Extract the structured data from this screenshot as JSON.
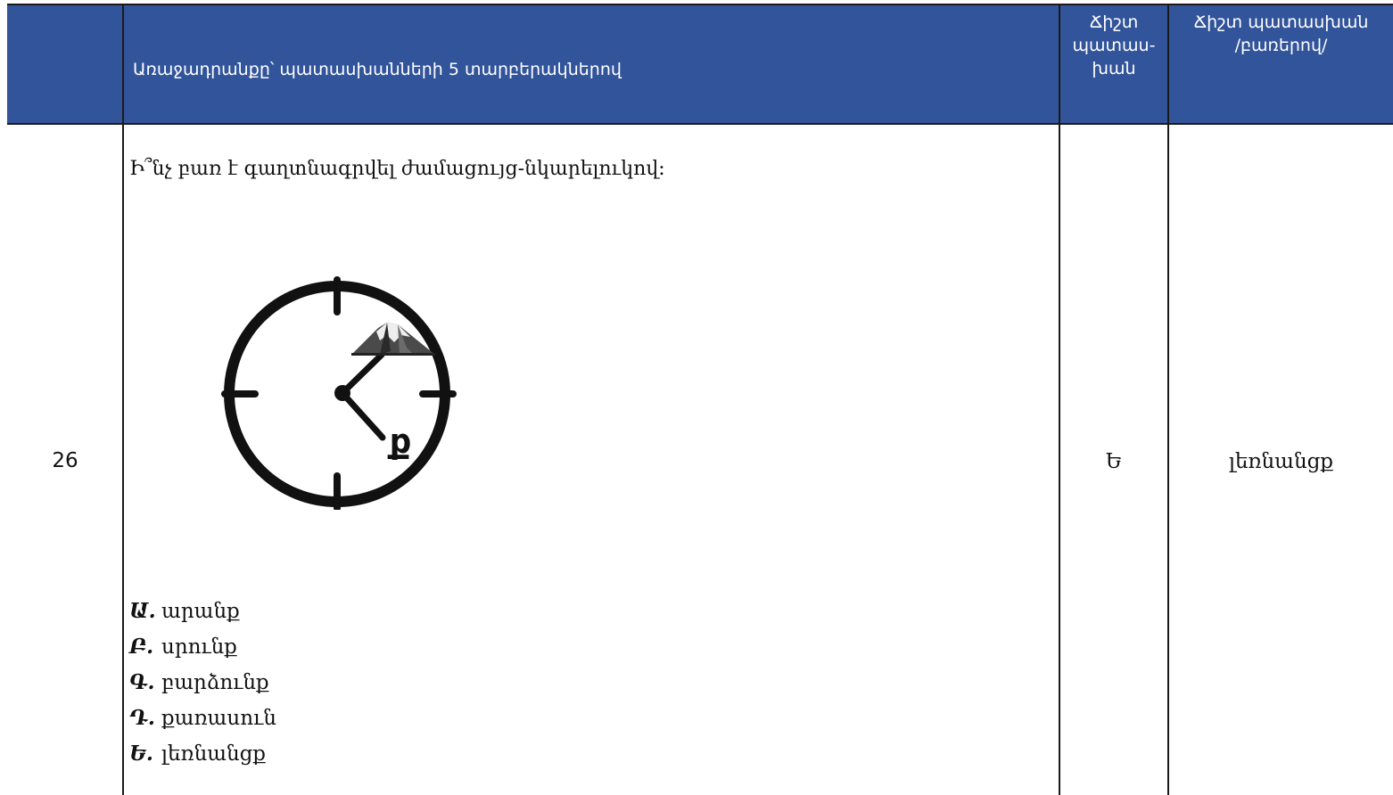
{
  "header": {
    "question_title": "Առաջադրանքը՝ պատասխանների 5 տարբերակներով",
    "answer_title_lines": [
      "Ճիշտ",
      "պատաս-",
      "խան"
    ],
    "word_title_lines": [
      "Ճիշտ պատասխան",
      "/բառերով/"
    ]
  },
  "row": {
    "number": "26",
    "question": "Ի՞նչ բառ է գաղտնագրվել ժամացույց-նկարելուկով։",
    "clock_letter": "ք",
    "options": [
      {
        "letter": "Ա.",
        "text": "արանք"
      },
      {
        "letter": "Բ.",
        "text": "սրունք"
      },
      {
        "letter": "Գ.",
        "text": "բարձունք"
      },
      {
        "letter": "Դ.",
        "text": "քառասուն"
      },
      {
        "letter": "Ե.",
        "text": "լեռնանցք"
      }
    ],
    "correct_answer": "Ե",
    "correct_word": "լեռնանցք"
  }
}
